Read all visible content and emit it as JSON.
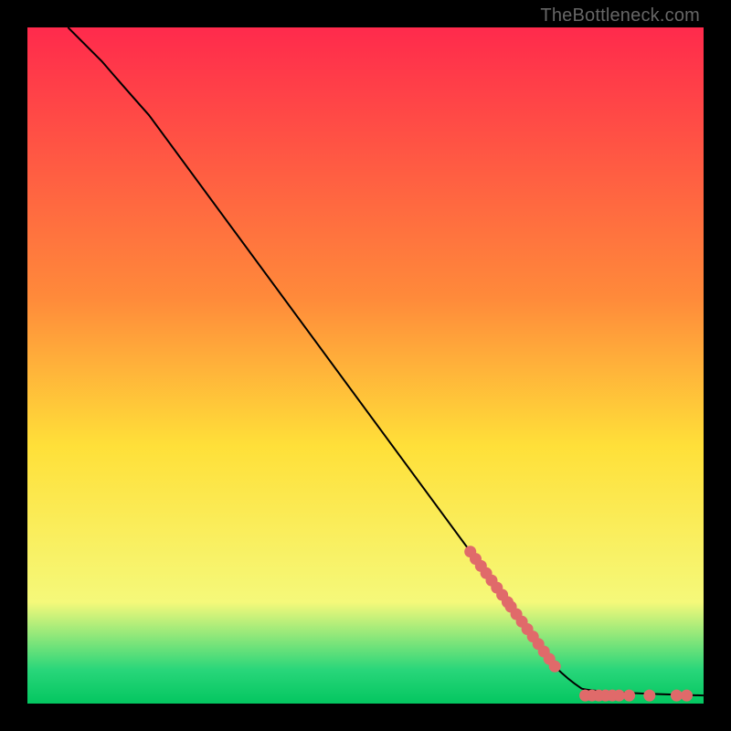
{
  "watermark": "TheBottleneck.com",
  "colors": {
    "frame": "#000000",
    "line": "#000000",
    "marker": "#e06a6a",
    "gradient_top": "#ff2a4c",
    "gradient_mid_upper": "#ff8a3a",
    "gradient_mid": "#ffe039",
    "gradient_mid_lower": "#f5f97a",
    "gradient_green": "#29d67a",
    "gradient_bottom": "#04c660"
  },
  "chart_data": {
    "type": "line",
    "title": "",
    "xlabel": "",
    "ylabel": "",
    "xlim": [
      0,
      100
    ],
    "ylim": [
      0,
      100
    ],
    "line_points": [
      {
        "x": 6,
        "y": 100
      },
      {
        "x": 8,
        "y": 98
      },
      {
        "x": 11,
        "y": 95
      },
      {
        "x": 14,
        "y": 91.5
      },
      {
        "x": 18,
        "y": 87
      },
      {
        "x": 78,
        "y": 5.5
      },
      {
        "x": 80,
        "y": 3.5
      },
      {
        "x": 82,
        "y": 2.2
      },
      {
        "x": 84,
        "y": 1.6
      },
      {
        "x": 100,
        "y": 1.2
      }
    ],
    "scatter_clusters": [
      {
        "along_line": true,
        "x_start": 65.5,
        "x_end": 71.0,
        "count": 8
      },
      {
        "along_line": true,
        "x_start": 71.5,
        "x_end": 78.0,
        "count": 9
      },
      {
        "along_line": false,
        "y": 1.2,
        "points_x": [
          82.5,
          83.5,
          84.5,
          85.5,
          86.5,
          87.5,
          89.0,
          92.0,
          96.0,
          97.5
        ]
      }
    ]
  }
}
